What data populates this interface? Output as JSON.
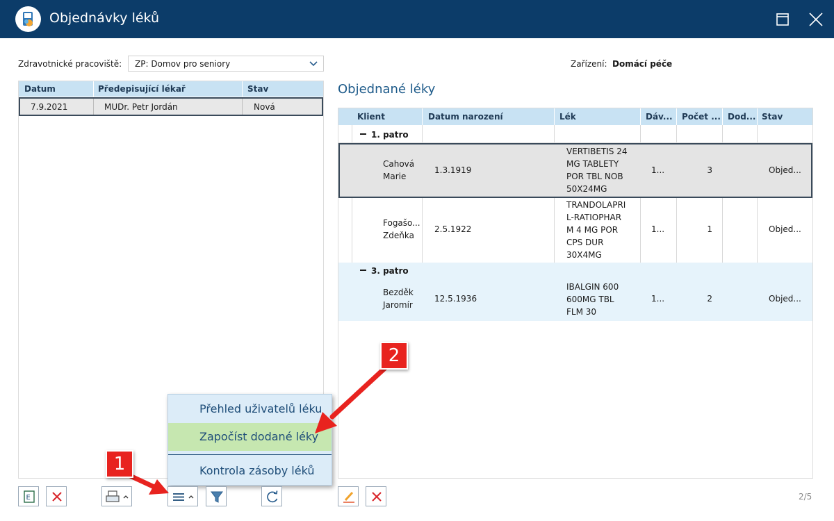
{
  "window": {
    "title": "Objednávky léků"
  },
  "workplace": {
    "label": "Zdravotnické pracoviště:",
    "value": "ZP: Domov pro seniory"
  },
  "facility": {
    "label": "Zařízení:",
    "value": "Domácí péče"
  },
  "orders_table": {
    "headers": [
      "Datum",
      "Předepisující lékař",
      "Stav"
    ],
    "rows": [
      {
        "date": "7.9.2021",
        "doctor": "MUDr. Petr Jordán",
        "status": "Nová"
      }
    ]
  },
  "ordered_meds": {
    "title": "Objednané léky",
    "headers": [
      "Klient",
      "Datum narození",
      "Lék",
      "Dáv...",
      "Počet ...",
      "Dod...",
      "Stav"
    ],
    "groups": [
      {
        "label": "1. patro",
        "rows": [
          {
            "client": "Cahová\nMarie",
            "dob": "1.3.1919",
            "drug": "VERTIBETIS 24\nMG TABLETY\nPOR TBL NOB\n50X24MG",
            "dose": "1...",
            "count": "3",
            "status": "Objed..."
          },
          {
            "client": "Fogašo...\nZdeňka",
            "dob": "2.5.1922",
            "drug": "TRANDOLAPRI\nL-RATIOPHAR\nM 4 MG POR\nCPS DUR\n30X4MG",
            "dose": "1...",
            "count": "1",
            "status": "Objed..."
          }
        ]
      },
      {
        "label": "3. patro",
        "rows": [
          {
            "client": "Bezděk\nJaromír",
            "dob": "12.5.1936",
            "drug": "IBALGIN 600\n600MG TBL\nFLM 30",
            "dose": "1...",
            "count": "2",
            "status": "Objed..."
          }
        ]
      }
    ]
  },
  "context_menu": {
    "items": [
      "Přehled uživatelů léku",
      "Započíst dodané léky",
      "Kontrola zásoby léků"
    ]
  },
  "callouts": [
    "1",
    "2"
  ],
  "pager": "2/5",
  "colors": {
    "titlebar": "#0c3c69",
    "header": "#c8e2f3",
    "menu": "#dcecf8",
    "menu_highlight": "#c6e7b0",
    "callout": "#e8231f"
  }
}
